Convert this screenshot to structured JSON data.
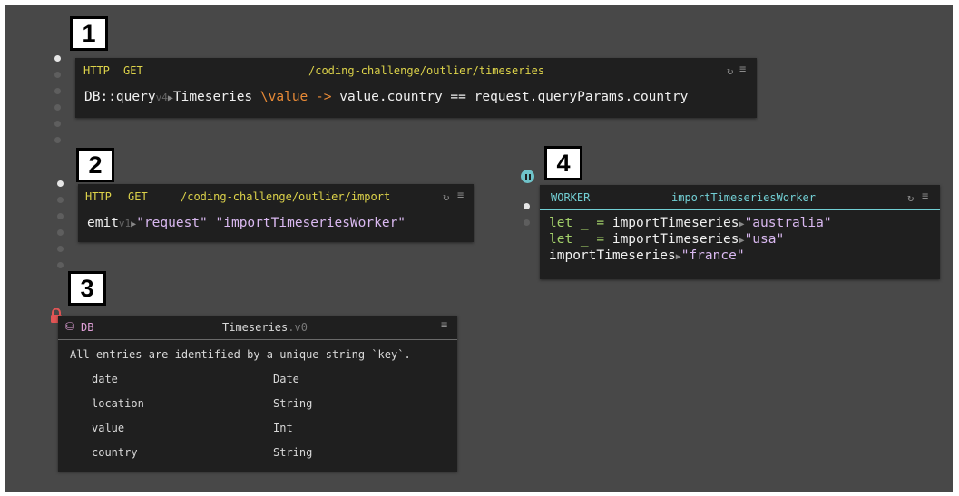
{
  "callouts": [
    "1",
    "2",
    "3",
    "4"
  ],
  "handler1": {
    "kind": "HTTP",
    "method": "GET",
    "route": "/coding-challenge/outlier/timeseries",
    "code": {
      "fn": "DB::query",
      "version": "v4",
      "arg": "Timeseries",
      "lambda": "\\value ->",
      "body": " value.country == request.queryParams.country"
    }
  },
  "handler2": {
    "kind": "HTTP",
    "method": "GET",
    "route": "/coding-challenge/outlier/import",
    "code": {
      "fn": "emit",
      "version": "v1",
      "arg1": "\"request\"",
      "arg2": "\"importTimeseriesWorker\""
    }
  },
  "db": {
    "kind": "DB",
    "name": "Timeseries",
    "version": ".v0",
    "description": "All entries are identified by a unique string `key`.",
    "fields": [
      {
        "name": "date",
        "type": "Date"
      },
      {
        "name": "location",
        "type": "String"
      },
      {
        "name": "value",
        "type": "Int"
      },
      {
        "name": "country",
        "type": "String"
      }
    ]
  },
  "worker": {
    "kind": "WORKER",
    "name": "importTimeseriesWorker",
    "lines": [
      {
        "prefix": "let _ = ",
        "fn": "importTimeseries",
        "arg": "\"australia\""
      },
      {
        "prefix": "let _ = ",
        "fn": "importTimeseries",
        "arg": "\"usa\""
      },
      {
        "prefix": "",
        "fn": "importTimeseries",
        "arg": "\"france\""
      }
    ]
  },
  "icons": {
    "refresh": "refresh-icon",
    "menu": "hamburger-menu-icon",
    "lock": "lock-icon",
    "database": "database-icon",
    "pause": "pause-icon"
  },
  "colors": {
    "canvas": "#484848",
    "panel": "#1f1f1f",
    "http_keyword": "#ddd34a",
    "worker_keyword": "#72cfd4",
    "string": "#d9b8f0",
    "lambda": "#e88a36",
    "lock": "#e05555"
  }
}
